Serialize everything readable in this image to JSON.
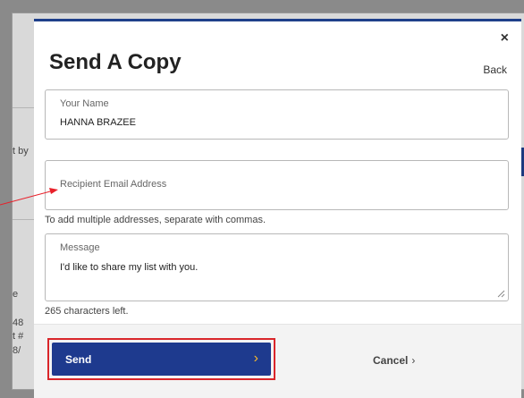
{
  "modal": {
    "title": "Send A Copy",
    "back_label": "Back",
    "close_glyph": "×"
  },
  "form": {
    "name": {
      "label": "Your Name",
      "value": "HANNA BRAZEE"
    },
    "email": {
      "placeholder": "Recipient Email Address",
      "helper": "To add multiple addresses, separate with commas."
    },
    "message": {
      "label": "Message",
      "value": "I'd like to share my list with you.",
      "chars_left": "265 characters left."
    }
  },
  "footer": {
    "send_label": "Send",
    "send_chevron": "›",
    "cancel_label": "Cancel",
    "cancel_chevron": "›"
  },
  "background_fragments": [
    "t by",
    "e",
    "48",
    "t #",
    "8/"
  ],
  "colors": {
    "primary_blue": "#1e3a8e",
    "chevron_yellow": "#f5b82e",
    "highlight_red": "#d9252a",
    "annotation_arrow": "#e8202a"
  }
}
